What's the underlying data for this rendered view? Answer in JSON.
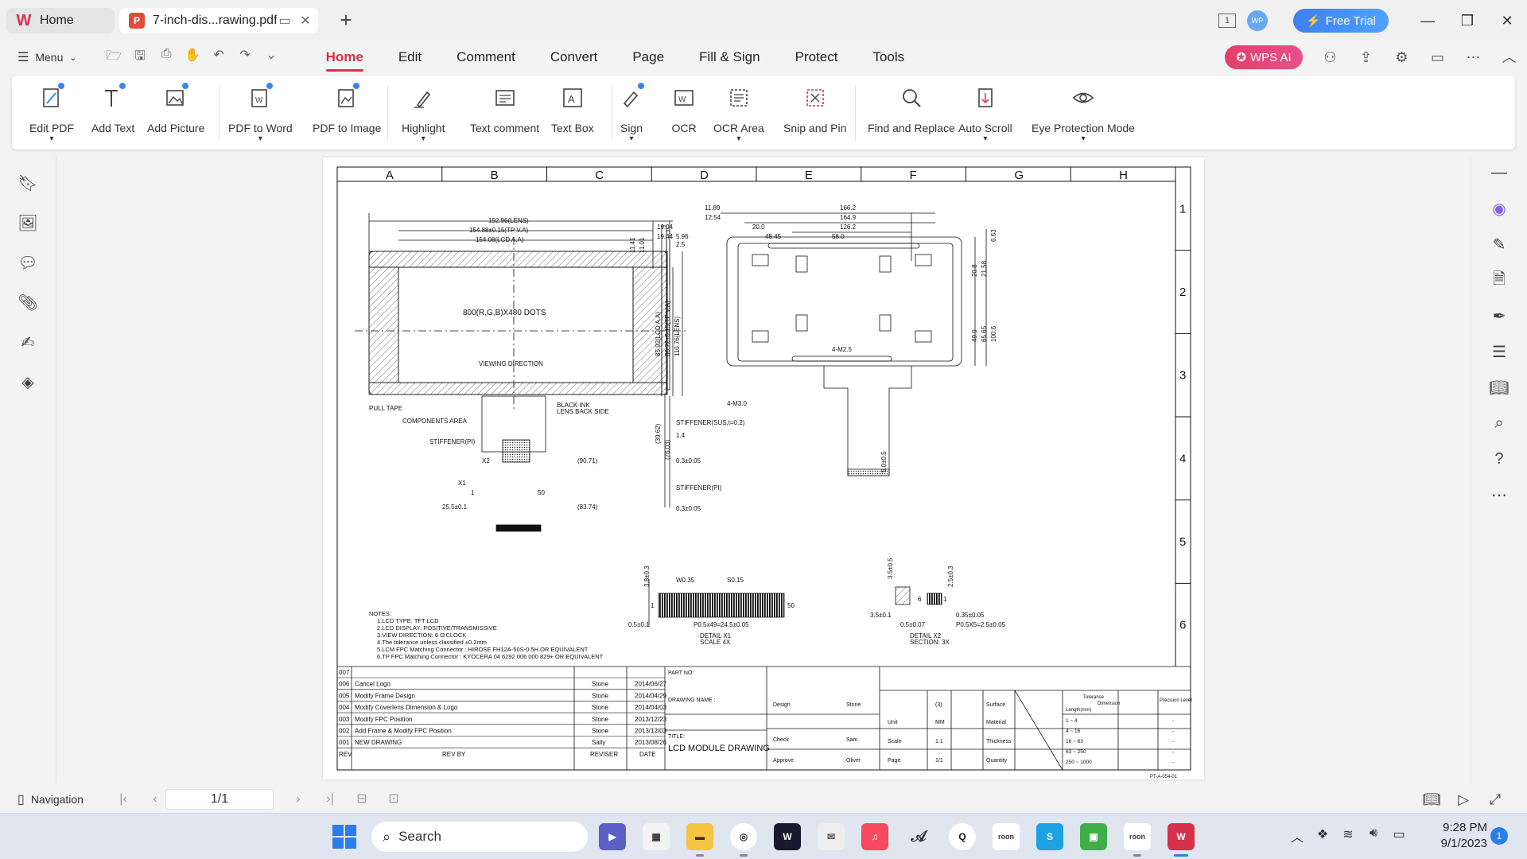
{
  "tabs": [
    {
      "label": "Home",
      "icon": "wps-logo-icon"
    },
    {
      "label": "7-inch-dis...rawing.pdf",
      "icon": "pdf-icon"
    }
  ],
  "titlebar": {
    "avatar": "WP",
    "free_trial": "Free Trial",
    "page_count_badge": "1"
  },
  "menu": {
    "menu_label": "Menu",
    "tabs": [
      "Home",
      "Edit",
      "Comment",
      "Convert",
      "Page",
      "Fill & Sign",
      "Protect",
      "Tools"
    ],
    "active_tab": "Home",
    "wps_ai": "WPS AI"
  },
  "ribbon": [
    {
      "label": "Edit PDF",
      "icon": "edit-pdf-icon",
      "dropdown": true
    },
    {
      "label": "Add Text",
      "icon": "add-text-icon"
    },
    {
      "label": "Add Picture",
      "icon": "add-picture-icon"
    },
    {
      "label": "PDF to Word",
      "icon": "pdf-to-word-icon",
      "dropdown": true
    },
    {
      "label": "PDF to Image",
      "icon": "pdf-to-image-icon"
    },
    {
      "label": "Highlight",
      "icon": "highlight-icon",
      "dropdown": true
    },
    {
      "label": "Text comment",
      "icon": "text-comment-icon"
    },
    {
      "label": "Text Box",
      "icon": "text-box-icon"
    },
    {
      "label": "Sign",
      "icon": "sign-icon",
      "dropdown": true
    },
    {
      "label": "OCR",
      "icon": "ocr-icon"
    },
    {
      "label": "OCR Area",
      "icon": "ocr-area-icon",
      "dropdown": true
    },
    {
      "label": "Snip and Pin",
      "icon": "snip-pin-icon"
    },
    {
      "label": "Find and Replace",
      "icon": "find-replace-icon"
    },
    {
      "label": "Auto Scroll",
      "icon": "auto-scroll-icon",
      "dropdown": true
    },
    {
      "label": "Eye Protection Mode",
      "icon": "eye-icon",
      "dropdown": true
    }
  ],
  "drawing": {
    "col_labels": [
      "A",
      "B",
      "C",
      "D",
      "E",
      "F",
      "G",
      "H"
    ],
    "row_labels": [
      "1",
      "2",
      "3",
      "4",
      "5",
      "6"
    ],
    "front_view": {
      "dims": [
        "192.96(LENS)",
        "154.88±0.15(TP V.A)",
        "154.08(LCD A.A)",
        "19.04",
        "19.44",
        "11.41",
        "11.01"
      ],
      "display_text": "800(R,G,B)X480  DOTS",
      "viewing": "VIEWING  DIRECTION",
      "side_dims": [
        "85.92(LCD A.A)",
        "86.72±0.15(TP V.A)",
        "110.76(LENS)",
        "(39.62)",
        "(76.03)"
      ],
      "labels": [
        "PULL TAPE",
        "BLACK INK",
        "LENS BACK SIDE",
        "COMPONENTS AREA",
        "STIFFENER(PI)",
        "X2",
        "X1",
        "1",
        "50",
        "(90.71)",
        "25.5±0.1",
        "(83.74)"
      ]
    },
    "side_view": {
      "labels": [
        "5.96",
        "2.5",
        "STIFFENER(SUS,t=0.2)",
        "1.4",
        "0.3±0.05",
        "STIFFENER(PI)",
        "0.3±0.05"
      ]
    },
    "back_view": {
      "top_dims": [
        "11.89",
        "12.54",
        "166.2",
        "164.9",
        "126.2",
        "58.0",
        "20.0",
        "48.45"
      ],
      "right_dims": [
        "6.63",
        "21.58",
        "20.8",
        "65.65",
        "49.0",
        "100.6"
      ],
      "labels": [
        "4-M2.5",
        "4-M3.0",
        "5.0±0.5"
      ]
    },
    "detail_x1": {
      "labels": [
        "3.8±0.3",
        "W0.35",
        "S0.15",
        "1",
        "50",
        "0.5±0.1",
        "P0.5x49=24.5±0.05"
      ],
      "caption": [
        "DETAIL  X1",
        "SCALE  4X"
      ]
    },
    "detail_x2": {
      "labels": [
        "3.5±0.5",
        "2.5±0.3",
        "6",
        "1",
        "3.5±0.1",
        "0.5±0.07",
        "0.35±0.05",
        "P0.5X5=2.5±0.05"
      ],
      "caption": [
        "DETAIL  X2",
        "SECTION: 3X"
      ]
    },
    "notes": [
      "NOTES:",
      "1.LCD  TYPE:  TFT  LCD",
      "2.LCD  DISPLAY:  POSITIVE/TRANSMISSIVE",
      "3.VIEW  DIRECTION:   6  O'CLOCK",
      "4.The  tolerance  unless  classified  ±0.2mm",
      "5.LCM  FPC  Matching  Connector  :  HIROSE  FH12A-50S-0.5H  OR  EQUIVALENT",
      "6.TP  FPC  Matching  Connector  :  KYOCERA  04  6292  006  000  829+  OR  EQUIVALENT"
    ],
    "revisions": [
      {
        "rev": "007",
        "desc": "",
        "by": "",
        "date": ""
      },
      {
        "rev": "006",
        "desc": "Cancel Logo",
        "by": "Stone",
        "date": "2014/06/27"
      },
      {
        "rev": "005",
        "desc": "Modify Frame Design",
        "by": "Stone",
        "date": "2014/04/29"
      },
      {
        "rev": "004",
        "desc": "Modify Coverlens Dimension & Logo",
        "by": "Stone",
        "date": "2014/04/03"
      },
      {
        "rev": "003",
        "desc": "Modify FPC Position",
        "by": "Stone",
        "date": "2013/12/23"
      },
      {
        "rev": "002",
        "desc": "Add Frame & Modify FPC Position",
        "by": "Stone",
        "date": "2013/12/03"
      },
      {
        "rev": "001",
        "desc": "NEW DRAWING",
        "by": "Sally",
        "date": "2013/08/26"
      }
    ],
    "rev_header": {
      "rev": "REV",
      "desc": "REV BY",
      "by": "REVISER",
      "date": "DATE"
    },
    "part_no": "PART NO:",
    "drawing_name": "DRAWING NAME :",
    "title_label": "TITLE:",
    "title": "LCD MODULE DRAWING",
    "signoff": [
      {
        "role": "Design",
        "name": "Stone"
      },
      {
        "role": "Check",
        "name": "Sam"
      },
      {
        "role": "Approve",
        "name": "Oliver"
      }
    ],
    "projection_label": "(3)",
    "unit": {
      "label": "Unit",
      "value": "MM"
    },
    "scale": {
      "label": "Scale",
      "value": "1:1"
    },
    "page": {
      "label": "Page",
      "value": "1/1"
    },
    "surface": [
      "Surface",
      "Material",
      "Thickness",
      "Quantity"
    ],
    "tolerance_head": [
      "Tolerance",
      "Dimension",
      "Length(mm)"
    ],
    "precision_head": "Precision Level",
    "tol_rows": [
      "1  ~  4",
      "4  ~  16",
      "16  ~  63",
      "63  ~  250",
      "250  ~  1000"
    ],
    "doc_code": "PT-A-054-01"
  },
  "navbar": {
    "label": "Navigation",
    "page": "1/1"
  },
  "taskbar": {
    "search": "Search",
    "time": "9:28 PM",
    "date": "9/1/2023",
    "notif": "1",
    "app_labels": {
      "roon1": "roon",
      "roon2": "roon"
    }
  },
  "colors": {
    "accent": "#d6304b",
    "wps_ai": "#e0406a",
    "free_trial": "#3f7ef6"
  }
}
